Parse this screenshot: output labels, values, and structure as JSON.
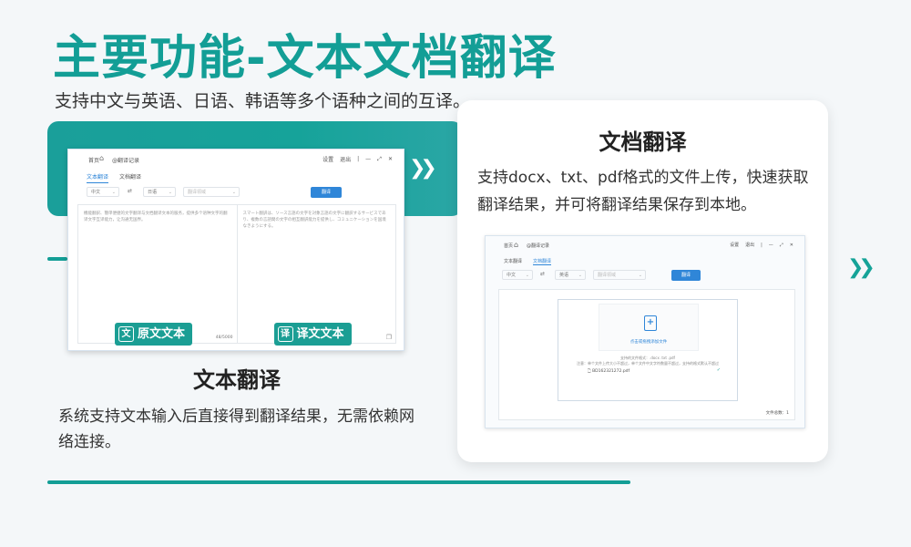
{
  "page": {
    "title": "主要功能-文本文档翻译",
    "subtitle": "支持中文与英语、日语、韩语等多个语种之间的互译。"
  },
  "text_feature": {
    "heading": "文本翻译",
    "description": "系统支持文本输入后直接得到翻译结果，无需依赖网络连接。"
  },
  "doc_feature": {
    "heading": "文档翻译",
    "description": "支持docx、txt、pdf格式的文件上传，快速获取翻译结果，并可将翻译结果保存到本地。"
  },
  "text_app": {
    "nav_home": "首页",
    "nav_history": "@翻译记录",
    "settings": "设置",
    "logout": "退出",
    "tabs": [
      "文本翻译",
      "文档翻译"
    ],
    "source_lang": "中文",
    "target_lang": "日语",
    "domain_placeholder": "翻译领域",
    "translate_button": "翻译",
    "source_text": "機能翻訳、簡単便捷的文字翻译与文档翻译文本的服务，提供多个语种文字的翻译文字互译能力，让沟通无国界。",
    "target_text": "スマート翻訳は、ソース言語の文字を対象言語の文字に翻訳するサービスであり、複数の言語間の文字の相互翻訳能力を提供し、コミュニケーションを国境なきようにする。",
    "char_count": "48/5000",
    "source_caption": "原文文本",
    "source_caption_icon": "文",
    "target_caption": "译文文本",
    "target_caption_icon": "译"
  },
  "doc_app": {
    "nav_home": "首页",
    "nav_history": "@翻译记录",
    "settings": "设置",
    "logout": "退出",
    "tabs": [
      "文本翻译",
      "文档翻译"
    ],
    "source_lang": "中文",
    "target_lang": "英语",
    "domain_placeholder": "翻译领域",
    "translate_button": "翻译",
    "drop_text": "点击或拖拽添加文件",
    "note_formats": "支持的文件格式：.docx .txt .pdf",
    "note_limits": "注意：单个文件上传大小不超过，单个文件中文字符数量不超过，支持的格式默认不超过",
    "file_name": "BD162321272.pdf",
    "file_count": "文件总数：1"
  }
}
